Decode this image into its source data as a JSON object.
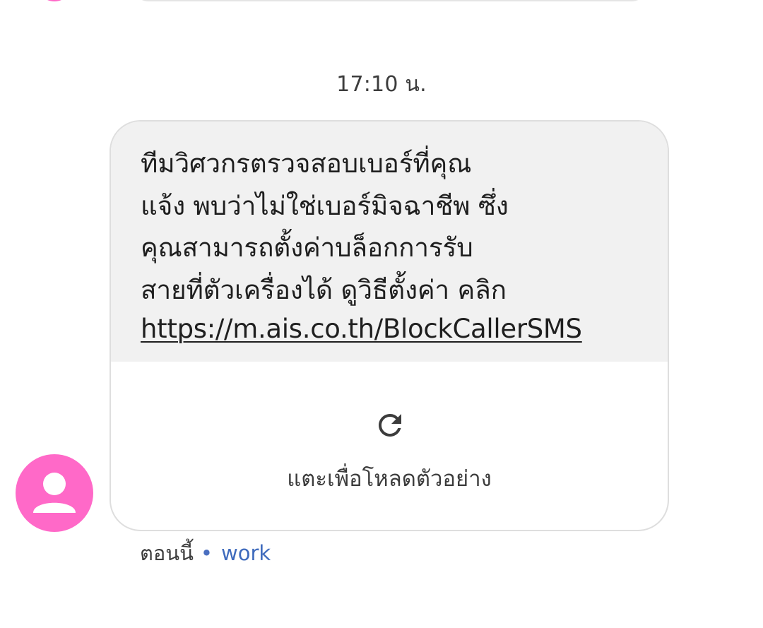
{
  "timestamp": "17:10 น.",
  "message": {
    "lines": [
      "ทีมวิศวกรตรวจสอบเบอร์ที่คุณ",
      "แจ้ง พบว่าไม่ใช่เบอร์มิจฉาชีพ ซึ่ง",
      "คุณสามารถตั้งค่าบล็อกการรับ",
      "สายที่ตัวเครื่องได้ ดูวิธีตั้งค่า คลิก"
    ],
    "link": "https://m.ais.co.th/BlockCallerSMS"
  },
  "preview": {
    "icon": "refresh-icon",
    "label": "แตะเพื่อโหลดตัวอย่าง"
  },
  "footer": {
    "status": "ตอนนี้",
    "separator": "•",
    "sim_label": "work"
  },
  "colors": {
    "avatar": "#ff69c8",
    "bubble_bg": "#f1f1f1",
    "link_sim": "#3f6bbd"
  }
}
